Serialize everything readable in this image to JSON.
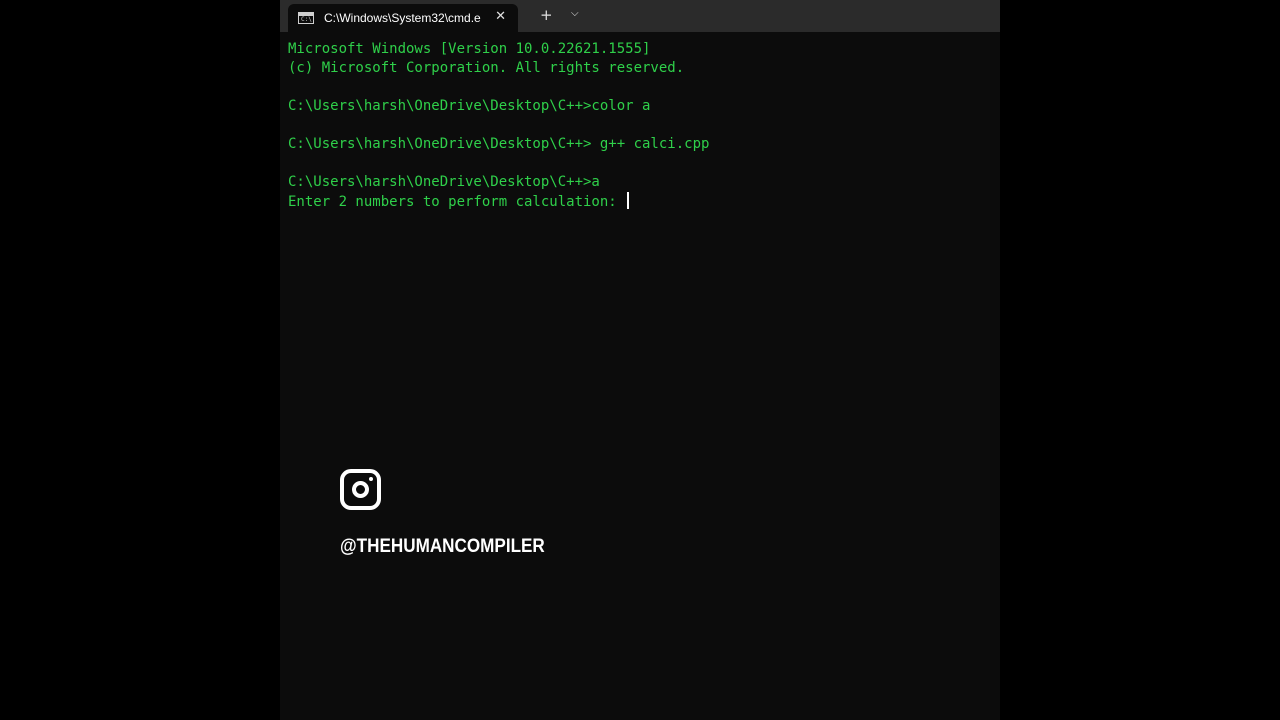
{
  "window": {
    "tab_title": "C:\\Windows\\System32\\cmd.e",
    "tab_icon_label": "C:\\",
    "close_glyph": "✕",
    "new_tab_glyph": "+",
    "dropdown_glyph": "⌵"
  },
  "console": {
    "text_color": "#2fd04a",
    "background": "#0c0c0c",
    "lines": [
      "Microsoft Windows [Version 10.0.22621.1555]",
      "(c) Microsoft Corporation. All rights reserved.",
      "",
      "C:\\Users\\harsh\\OneDrive\\Desktop\\C++>color a",
      "",
      "C:\\Users\\harsh\\OneDrive\\Desktop\\C++> g++ calci.cpp",
      "",
      "C:\\Users\\harsh\\OneDrive\\Desktop\\C++>a",
      "Enter 2 numbers to perform calculation: "
    ]
  },
  "overlay": {
    "icon": "instagram-icon",
    "handle": "@THEHUMANCOMPILER"
  }
}
